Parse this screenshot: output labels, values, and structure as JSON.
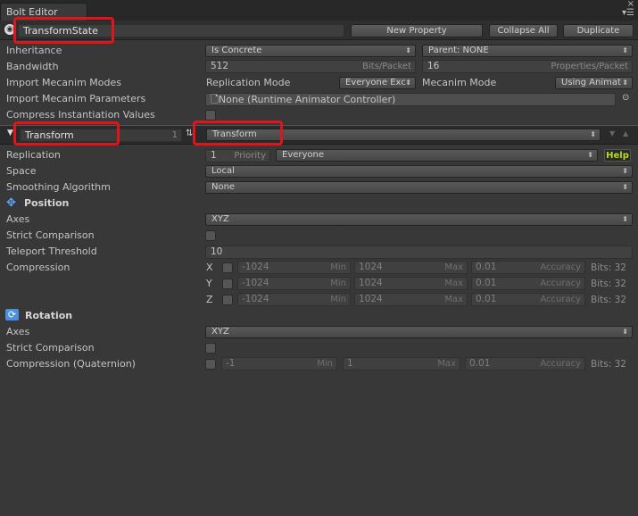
{
  "window": {
    "tab_title": "Bolt Editor"
  },
  "toolbar": {
    "state_name": "TransformState",
    "new_property": "New Property",
    "collapse_all": "Collapse All",
    "duplicate": "Duplicate"
  },
  "state": {
    "inheritance_label": "Inheritance",
    "inheritance_value": "Is Concrete",
    "parent_value": "Parent: NONE",
    "bandwidth_label": "Bandwidth",
    "bandwidth_value": "512",
    "bandwidth_unit": "Bits/Packet",
    "properties_value": "16",
    "properties_unit": "Properties/Packet",
    "import_modes_label": "Import Mecanim Modes",
    "replication_mode_label": "Replication Mode",
    "replication_mode_value": "Everyone Exc",
    "mecanim_mode_label": "Mecanim Mode",
    "mecanim_mode_value": "Using Animat",
    "import_params_label": "Import Mecanim Parameters",
    "animator_value": "None (Runtime Animator Controller)",
    "compress_label": "Compress Instantiation Values"
  },
  "property": {
    "name": "Transform",
    "index": "1",
    "type": "Transform",
    "replication_label": "Replication",
    "replication_priority": "1",
    "priority_unit": "Priority",
    "replication_target": "Everyone",
    "help": "Help",
    "space_label": "Space",
    "space_value": "Local",
    "smoothing_label": "Smoothing Algorithm",
    "smoothing_value": "None"
  },
  "position": {
    "header": "Position",
    "axes_label": "Axes",
    "axes_value": "XYZ",
    "strict_label": "Strict Comparison",
    "teleport_label": "Teleport Threshold",
    "teleport_value": "10",
    "compression_label": "Compression",
    "min_unit": "Min",
    "max_unit": "Max",
    "acc_unit": "Accuracy",
    "rows": [
      {
        "axis": "X",
        "min": "-1024",
        "max": "1024",
        "acc": "0.01",
        "bits": "Bits: 32"
      },
      {
        "axis": "Y",
        "min": "-1024",
        "max": "1024",
        "acc": "0.01",
        "bits": "Bits: 32"
      },
      {
        "axis": "Z",
        "min": "-1024",
        "max": "1024",
        "acc": "0.01",
        "bits": "Bits: 32"
      }
    ]
  },
  "rotation": {
    "header": "Rotation",
    "axes_label": "Axes",
    "axes_value": "XYZ",
    "strict_label": "Strict Comparison",
    "quat_label": "Compression (Quaternion)",
    "min": "-1",
    "max": "1",
    "acc": "0.01",
    "bits": "Bits: 32",
    "min_unit": "Min",
    "max_unit": "Max",
    "acc_unit": "Accuracy"
  },
  "colors": {
    "highlight": "#e0141a",
    "help_bg": "#b6e01a"
  }
}
